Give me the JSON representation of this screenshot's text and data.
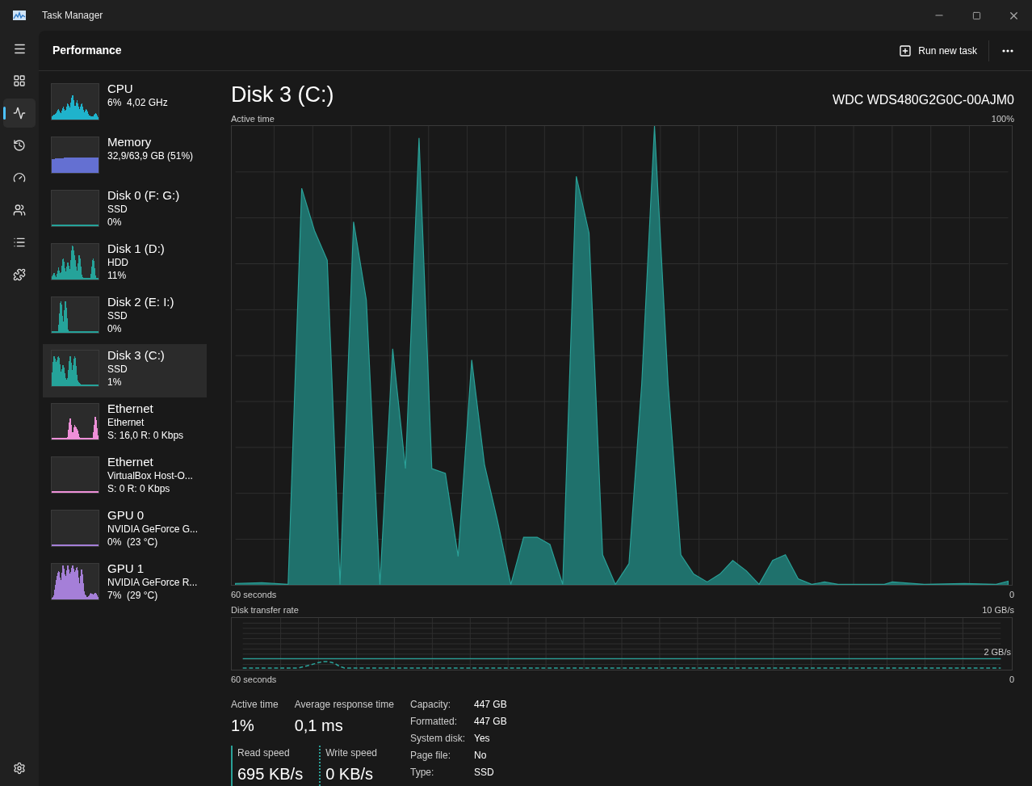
{
  "window": {
    "title": "Task Manager"
  },
  "nav": [
    {
      "selected": false
    },
    {
      "selected": true
    },
    {
      "selected": false
    },
    {
      "selected": false
    },
    {
      "selected": false
    },
    {
      "selected": false
    },
    {
      "selected": false
    }
  ],
  "header": {
    "title": "Performance",
    "action": "Run new task"
  },
  "resources": [
    {
      "name": "CPU",
      "lines": [
        "6%  4,02 GHz"
      ],
      "color": "#1fb3cc",
      "selected": false
    },
    {
      "name": "Memory",
      "lines": [
        "32,9/63,9 GB (51%)"
      ],
      "color": "#6470d2",
      "selected": false
    },
    {
      "name": "Disk 0 (F: G:)",
      "lines": [
        "SSD",
        "0%"
      ],
      "color": "#25a39a",
      "selected": false
    },
    {
      "name": "Disk 1 (D:)",
      "lines": [
        "HDD",
        "11%"
      ],
      "color": "#25a39a",
      "selected": false
    },
    {
      "name": "Disk 2 (E: I:)",
      "lines": [
        "SSD",
        "0%"
      ],
      "color": "#25a39a",
      "selected": false
    },
    {
      "name": "Disk 3 (C:)",
      "lines": [
        "SSD",
        "1%"
      ],
      "color": "#25a39a",
      "selected": true
    },
    {
      "name": "Ethernet",
      "lines": [
        "Ethernet",
        "S: 16,0 R: 0 Kbps"
      ],
      "color": "#ee8fd8",
      "selected": false
    },
    {
      "name": "Ethernet",
      "lines": [
        "VirtualBox Host-O...",
        "S: 0 R: 0 Kbps"
      ],
      "color": "#ee8fd8",
      "selected": false
    },
    {
      "name": "GPU 0",
      "lines": [
        "NVIDIA GeForce G...",
        "0%  (23 °C)"
      ],
      "color": "#a57fd8",
      "selected": false
    },
    {
      "name": "GPU 1",
      "lines": [
        "NVIDIA GeForce R...",
        "7%  (29 °C)"
      ],
      "color": "#a57fd8",
      "selected": false
    }
  ],
  "detail": {
    "title": "Disk 3 (C:)",
    "model": "WDC WDS480G2G0C-00AJM0",
    "active_chart": {
      "label": "Active time",
      "max": "100%",
      "x_start": "60 seconds",
      "x_end": "0"
    },
    "transfer_chart": {
      "label": "Disk transfer rate",
      "max": "10 GB/s",
      "mark": "2 GB/s",
      "x_start": "60 seconds",
      "x_end": "0"
    },
    "stats": [
      {
        "label": "Active time",
        "value": "1%"
      },
      {
        "label": "Average response time",
        "value": "0,1 ms"
      }
    ],
    "speeds": [
      {
        "label": "Read speed",
        "value": "695 KB/s",
        "kind": "read"
      },
      {
        "label": "Write speed",
        "value": "0 KB/s",
        "kind": "write"
      }
    ],
    "properties": [
      {
        "label": "Capacity:",
        "value": "447 GB"
      },
      {
        "label": "Formatted:",
        "value": "447 GB"
      },
      {
        "label": "System disk:",
        "value": "Yes"
      },
      {
        "label": "Page file:",
        "value": "No"
      },
      {
        "label": "Type:",
        "value": "SSD"
      }
    ]
  }
}
